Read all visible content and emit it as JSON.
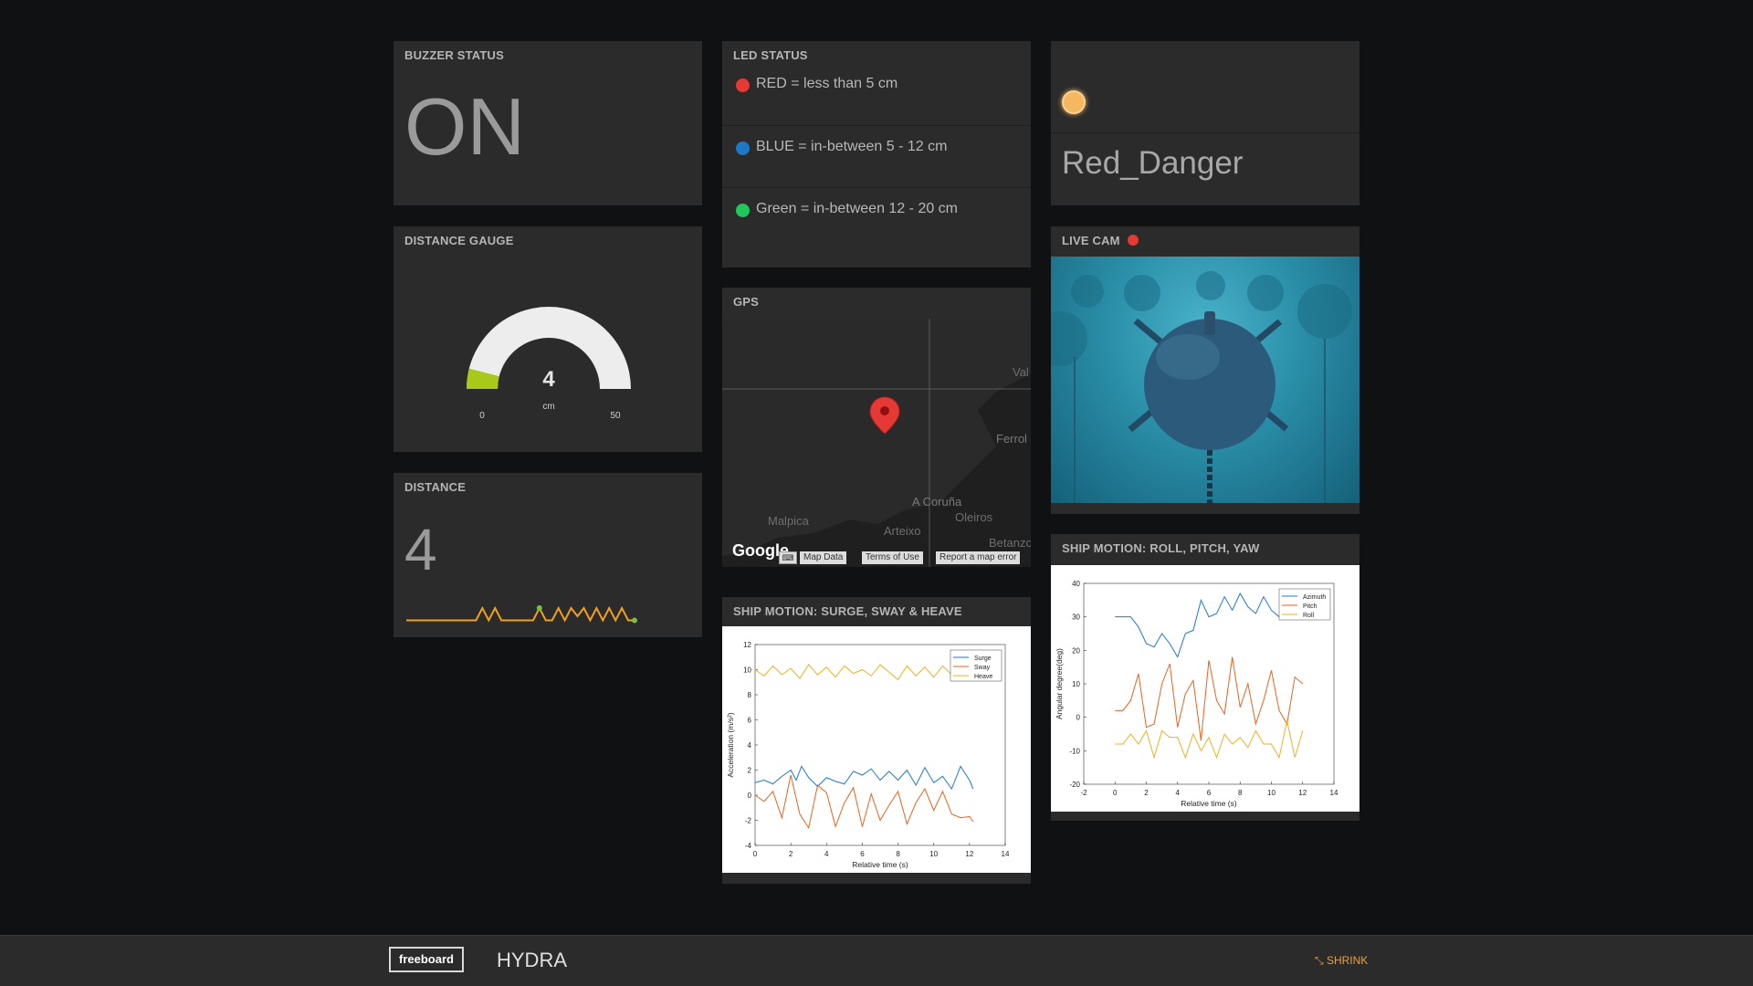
{
  "buzzer": {
    "title": "BUZZER STATUS",
    "value": "ON"
  },
  "led_status": {
    "title": "LED STATUS",
    "items": [
      {
        "label": "RED = less than 5 cm",
        "color": "#e53935"
      },
      {
        "label": "BLUE = in-between 5 - 12 cm",
        "color": "#1e78c8"
      },
      {
        "label": "Green = in-between 12 - 20 cm",
        "color": "#1ec85a"
      }
    ]
  },
  "indicator": {
    "light_color": "#f5b860",
    "value": "Red_Danger"
  },
  "gauge": {
    "title": "DISTANCE GAUGE",
    "value": "4",
    "unit": "cm",
    "min": "0",
    "max": "50",
    "fill_color": "#a8c81a",
    "value_fraction": 0.08
  },
  "distance": {
    "title": "DISTANCE",
    "value": "4",
    "sparkline_color": "#f0a020",
    "sparkline_values": [
      1,
      1,
      1,
      1,
      1,
      1,
      1,
      1,
      1,
      1,
      1,
      1,
      4,
      1,
      4,
      1,
      1,
      1,
      1,
      1,
      1,
      4,
      1,
      1,
      4,
      1,
      4,
      2,
      4,
      1,
      4,
      1,
      4,
      1,
      4,
      1,
      1
    ]
  },
  "gps": {
    "title": "GPS",
    "places": [
      "Val",
      "Ferrol",
      "A Coruña",
      "Oleiros",
      "Malpica",
      "Arteixo",
      "Betanzo"
    ],
    "google_logo": "Google",
    "map_data": "Map Data",
    "terms": "Terms of Use",
    "report": "Report a map error"
  },
  "live_cam": {
    "title": "LIVE CAM",
    "rec_color": "#e53935"
  },
  "ship_surge": {
    "title": "SHIP MOTION: SURGE, SWAY & HEAVE",
    "chart_data": {
      "type": "line",
      "xlabel": "Relative time (s)",
      "ylabel": "Acceleration (m/s²)",
      "xlim": [
        0,
        14
      ],
      "ylim": [
        -4,
        12
      ],
      "xticks": [
        0,
        2,
        4,
        6,
        8,
        10,
        12,
        14
      ],
      "yticks": [
        -4,
        -2,
        0,
        2,
        4,
        6,
        8,
        10,
        12
      ],
      "legend": "top-right",
      "series": [
        {
          "name": "Surge",
          "color": "#1f77d4",
          "x": [
            0,
            0.5,
            1,
            1.5,
            2,
            2.3,
            2.6,
            3,
            3.5,
            4,
            4.5,
            5,
            5.5,
            6,
            6.5,
            7,
            7.5,
            8,
            8.5,
            9,
            9.5,
            10,
            10.5,
            11,
            11.5,
            12,
            12.2
          ],
          "y": [
            1,
            1.2,
            0.9,
            1.5,
            2,
            1.2,
            2.3,
            1.4,
            0.7,
            1.4,
            1.1,
            0.9,
            1.9,
            1.6,
            2.1,
            1.2,
            1.9,
            1.2,
            2.0,
            0.8,
            2.2,
            1.0,
            1.5,
            0.5,
            2.3,
            1.2,
            0.5
          ]
        },
        {
          "name": "Sway",
          "color": "#e8621e",
          "x": [
            0,
            0.5,
            1,
            1.5,
            2,
            2.5,
            3,
            3.5,
            4,
            4.5,
            5,
            5.5,
            6,
            6.5,
            7,
            7.5,
            8,
            8.5,
            9,
            9.5,
            10,
            10.5,
            11,
            11.5,
            12,
            12.2
          ],
          "y": [
            0,
            -0.5,
            0.3,
            -1.8,
            1.6,
            -1.5,
            -2.6,
            0.8,
            0.2,
            -2.5,
            -0.6,
            0.6,
            -2.5,
            0.1,
            -2.0,
            -0.8,
            0.3,
            -2.3,
            -0.6,
            0.5,
            -1.2,
            0.3,
            -1.5,
            -1.8,
            -1.7,
            -2.1
          ]
        },
        {
          "name": "Heave",
          "color": "#f0b020",
          "x": [
            0,
            0.5,
            1,
            1.5,
            2,
            2.5,
            3,
            3.5,
            4,
            4.5,
            5,
            5.5,
            6,
            6.5,
            7,
            7.5,
            8,
            8.5,
            9,
            9.5,
            10,
            10.5,
            11,
            11.5,
            12,
            12.2
          ],
          "y": [
            10,
            9.5,
            10.3,
            9.6,
            10.1,
            9.3,
            10.4,
            9.6,
            10.2,
            9.4,
            10.3,
            9.7,
            10.0,
            9.5,
            10.4,
            9.8,
            9.2,
            10.3,
            9.5,
            10.2,
            9.4,
            10.3,
            9.6,
            10.1,
            9.7,
            10.0
          ]
        }
      ]
    }
  },
  "ship_roll": {
    "title": "SHIP MOTION: ROLL, PITCH, YAW",
    "chart_data": {
      "type": "line",
      "xlabel": "Relative time (s)",
      "ylabel": "Angular degree(deg)",
      "xlim": [
        -2,
        14
      ],
      "ylim": [
        -20,
        40
      ],
      "xticks": [
        -2,
        0,
        2,
        4,
        6,
        8,
        10,
        12,
        14
      ],
      "yticks": [
        -20,
        -10,
        0,
        10,
        20,
        30,
        40
      ],
      "legend": "top-right",
      "series": [
        {
          "name": "Azimuth",
          "color": "#1f77d4",
          "x": [
            0,
            0.5,
            1,
            1.5,
            2,
            2.5,
            3,
            3.5,
            4,
            4.5,
            5,
            5.5,
            6,
            6.5,
            7,
            7.5,
            8,
            8.5,
            9,
            9.5,
            10,
            10.5,
            11,
            11.5,
            12
          ],
          "y": [
            30,
            30,
            30,
            27,
            22,
            21,
            25,
            22,
            18,
            25,
            26,
            35,
            30,
            31,
            36,
            32,
            37,
            33,
            31,
            36,
            32,
            30,
            31,
            34,
            33
          ]
        },
        {
          "name": "Pitch",
          "color": "#e8621e",
          "x": [
            0,
            0.5,
            1,
            1.5,
            2,
            2.5,
            3,
            3.5,
            4,
            4.5,
            5,
            5.5,
            6,
            6.5,
            7,
            7.5,
            8,
            8.5,
            9,
            9.5,
            10,
            10.5,
            11,
            11.5,
            12
          ],
          "y": [
            2,
            2,
            5,
            13,
            -3,
            -2,
            10,
            16,
            -3,
            7,
            11,
            -7,
            17,
            5,
            1,
            18,
            3,
            10,
            -2,
            5,
            14,
            2,
            -2,
            12,
            10
          ]
        },
        {
          "name": "Roll",
          "color": "#f0b020",
          "x": [
            0,
            0.5,
            1,
            1.5,
            2,
            2.5,
            3,
            3.5,
            4,
            4.5,
            5,
            5.5,
            6,
            6.5,
            7,
            7.5,
            8,
            8.5,
            9,
            9.5,
            10,
            10.5,
            11,
            11.5,
            12
          ],
          "y": [
            -8,
            -8,
            -5,
            -8,
            -4,
            -12,
            -4,
            -6,
            -6,
            -12,
            -5,
            -10,
            -6,
            -12,
            -5,
            -8,
            -6,
            -9,
            -4,
            -8,
            -8,
            -12,
            -1,
            -12,
            -4
          ]
        }
      ]
    }
  },
  "footer": {
    "logo": "freeboard",
    "title": "HYDRA",
    "shrink": "SHRINK",
    "shrink_color": "#e6a23c"
  }
}
